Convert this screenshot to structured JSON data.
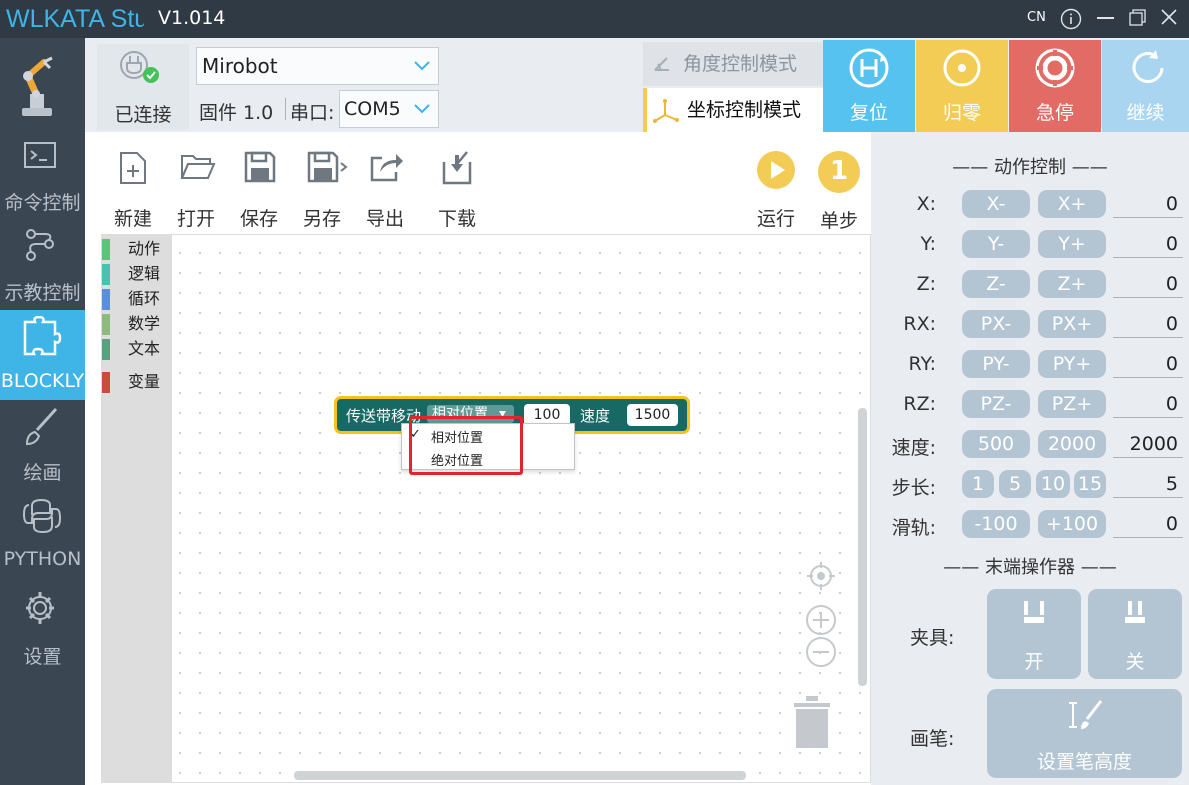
{
  "window": {
    "logo": "WLKATA Studio",
    "version": "V1.014",
    "lang": "CN",
    "info_icon": "info-icon",
    "min_icon": "minimize-icon",
    "max_icon": "maximize-icon",
    "close_icon": "close-icon"
  },
  "sidebar": {
    "items": [
      {
        "label": "",
        "icon": "robot-arm-icon"
      },
      {
        "label": "命令控制",
        "icon": "terminal-icon"
      },
      {
        "label": "示教控制",
        "icon": "teach-path-icon"
      },
      {
        "label": "BLOCKLY",
        "icon": "puzzle-icon",
        "active": true
      },
      {
        "label": "绘画",
        "icon": "brush-icon"
      },
      {
        "label": "PYTHON",
        "icon": "python-icon"
      },
      {
        "label": "设置",
        "icon": "gear-icon"
      }
    ]
  },
  "connection": {
    "status": "已连接",
    "robot": "Mirobot",
    "firmware": "固件 1.0",
    "port_label": "串口:",
    "port": "COM5"
  },
  "modes": {
    "angle": "角度控制模式",
    "coord": "坐标控制模式"
  },
  "actions": [
    {
      "label": "复位",
      "color": "#55c2ef"
    },
    {
      "label": "归零",
      "color": "#f3cc55"
    },
    {
      "label": "急停",
      "color": "#e26b65"
    },
    {
      "label": "继续",
      "color": "#a9d5f1"
    }
  ],
  "toolbar": {
    "new": "新建",
    "open": "打开",
    "save": "保存",
    "saveas": "另存",
    "export": "导出",
    "download": "下载",
    "run": "运行",
    "step": "单步",
    "step_num": "1"
  },
  "categories": [
    {
      "label": "动作",
      "color": "#5ec278"
    },
    {
      "label": "逻辑",
      "color": "#47c2b1"
    },
    {
      "label": "循环",
      "color": "#5b8fd8"
    },
    {
      "label": "数学",
      "color": "#8fba7f"
    },
    {
      "label": "文本",
      "color": "#5aa07f"
    },
    {
      "label": "变量",
      "color": "#c84b3c"
    }
  ],
  "block": {
    "label": "传送带移动",
    "mode": "相对位置",
    "distance": "100",
    "speed_label": "速度",
    "speed": "1500"
  },
  "dropdown": {
    "items": [
      "相对位置",
      "绝对位置"
    ],
    "check": "✓"
  },
  "motion": {
    "title": "—— 动作控制 ——",
    "rows": [
      {
        "label": "X:",
        "minus": "X-",
        "plus": "X+",
        "value": "0"
      },
      {
        "label": "Y:",
        "minus": "Y-",
        "plus": "Y+",
        "value": "0"
      },
      {
        "label": "Z:",
        "minus": "Z-",
        "plus": "Z+",
        "value": "0"
      },
      {
        "label": "RX:",
        "minus": "PX-",
        "plus": "PX+",
        "value": "0"
      },
      {
        "label": "RY:",
        "minus": "PY-",
        "plus": "PY+",
        "value": "0"
      },
      {
        "label": "RZ:",
        "minus": "PZ-",
        "plus": "PZ+",
        "value": "0"
      }
    ],
    "speed_label": "速度:",
    "speed_a": "500",
    "speed_b": "2000",
    "speed_value": "2000",
    "step_label": "步长:",
    "steps": [
      "1",
      "5",
      "10",
      "15"
    ],
    "step_value": "5",
    "rail_label": "滑轨:",
    "rail_minus": "-100",
    "rail_plus": "+100",
    "rail_value": "0"
  },
  "effector": {
    "title": "—— 末端操作器 ——",
    "gripper_label": "夹具:",
    "open": "开",
    "close": "关",
    "pen_label": "画笔:",
    "pen_height": "设置笔高度"
  }
}
